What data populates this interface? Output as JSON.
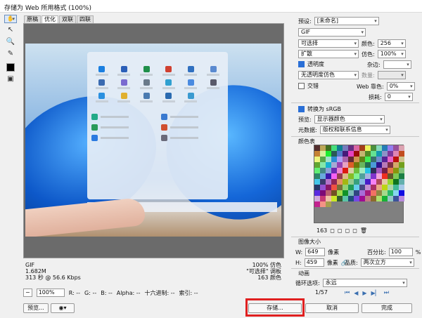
{
  "window_title": "存储为 Web 所用格式 (100%)",
  "tabs": [
    "原稿",
    "优化",
    "双联",
    "四联"
  ],
  "active_tab": 1,
  "info": {
    "left": [
      "GIF",
      "1.682M",
      "313 秒 @ 56.6 Kbps"
    ],
    "right": [
      "100% 仿色",
      "\"可选择\" 调板",
      "163 颜色"
    ]
  },
  "status": {
    "zoom": "100%",
    "r": "R: --",
    "g": "G: --",
    "b": "B: --",
    "alpha": "Alpha: --",
    "hex": "十六进制: --",
    "index": "索引: --"
  },
  "bottom_buttons": {
    "preview": "预览...",
    "save": "存储...",
    "cancel": "取消",
    "done": "完成"
  },
  "settings": {
    "preset_label": "预设:",
    "preset_value": "[未命名]",
    "format": "GIF",
    "reduction": "可选择",
    "colors_label": "颜色:",
    "colors_value": "256",
    "dither_algo": "扩散",
    "dither_label": "仿色:",
    "dither_value": "100%",
    "transparency_label": "透明度",
    "matte_label": "杂边:",
    "trans_dither": "无透明度仿色",
    "amount_label": "数量:",
    "interlaced_label": "交错",
    "web_snap_label": "Web 靠色:",
    "web_snap_value": "0%",
    "lossy_label": "损耗:",
    "lossy_value": "0",
    "srgb_label": "转换为 sRGB",
    "preview_label": "预览:",
    "preview_value": "显示器颜色",
    "metadata_label": "元数据:",
    "metadata_value": "版权和联系信息",
    "color_table_label": "颜色表",
    "color_count": "163",
    "image_size_label": "图像大小",
    "w_label": "W:",
    "w_value": "649",
    "h_label": "H:",
    "h_value": "459",
    "px": "像素",
    "percent_label": "百分比:",
    "percent_value": "100",
    "percent_sign": "%",
    "quality_label": "品质:",
    "quality_value": "两次立方",
    "animation_label": "动画",
    "loop_label": "循环选项:",
    "loop_value": "永远",
    "frame": "1/57"
  },
  "colors": {
    "accent": "#2a6fd6",
    "highlight": "#e02020"
  }
}
